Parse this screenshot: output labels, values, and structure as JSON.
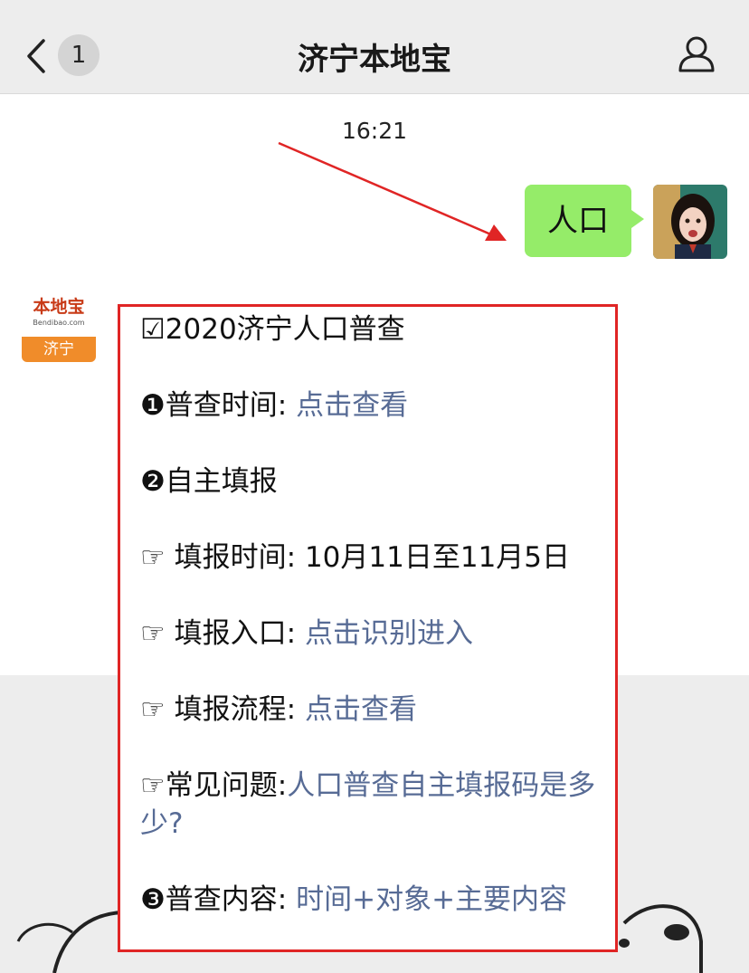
{
  "navbar": {
    "back_count": "1",
    "title": "济宁本地宝"
  },
  "chat": {
    "timestamp": "16:21",
    "my_message": "人口"
  },
  "account": {
    "logo_text": "本地宝",
    "logo_sub": "Bendibao.com",
    "city": "济宁"
  },
  "reply": {
    "header": "☑2020济宁人口普查",
    "item1_label": "❶普查时间:",
    "item1_link": "点击查看",
    "item2_label": "❷自主填报",
    "fill_time_label": "☞ 填报时间:",
    "fill_time_value": "10月11日至11月5日",
    "fill_entry_label": "☞ 填报入口:",
    "fill_entry_link": "点击识别进入",
    "fill_flow_label": "☞ 填报流程:",
    "fill_flow_link": "点击查看",
    "faq_label": "☞常见问题:",
    "faq_link": "人口普查自主填报码是多少?",
    "item3_label": "❸普查内容:",
    "item3_link": "时间+对象+主要内容"
  },
  "colors": {
    "navbar_bg": "#ededed",
    "my_bubble": "#95ec69",
    "link": "#576b95",
    "highlight_border": "#e02525",
    "annotation_arrow": "#e02525"
  },
  "icons": [
    "chevron-left-icon",
    "person-icon"
  ]
}
